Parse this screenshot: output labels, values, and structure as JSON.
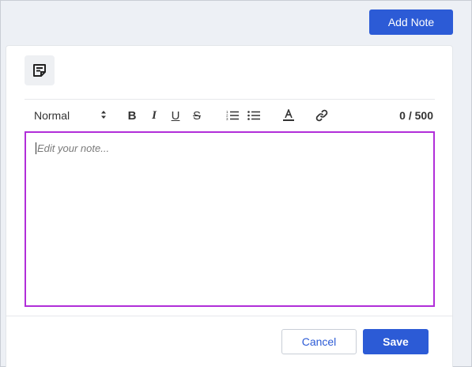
{
  "header": {
    "add_note_label": "Add Note"
  },
  "note_card": {
    "icon": "sticky-note-icon",
    "toolbar": {
      "format_value": "Normal",
      "format_icon": "up-down-chevron-icon",
      "bold_label": "B",
      "italic_label": "I",
      "underline_label": "U",
      "strike_label": "S",
      "ordered_list_icon": "ordered-list-icon",
      "bullet_list_icon": "bullet-list-icon",
      "text_color_icon": "text-color-icon",
      "link_icon": "link-icon",
      "char_count": "0 / 500"
    },
    "editor": {
      "placeholder": "Edit your note...",
      "focus_border_color": "#b12ed9"
    },
    "footer": {
      "cancel_label": "Cancel",
      "save_label": "Save"
    }
  },
  "colors": {
    "primary": "#2c5bd6",
    "background": "#edf0f5"
  }
}
